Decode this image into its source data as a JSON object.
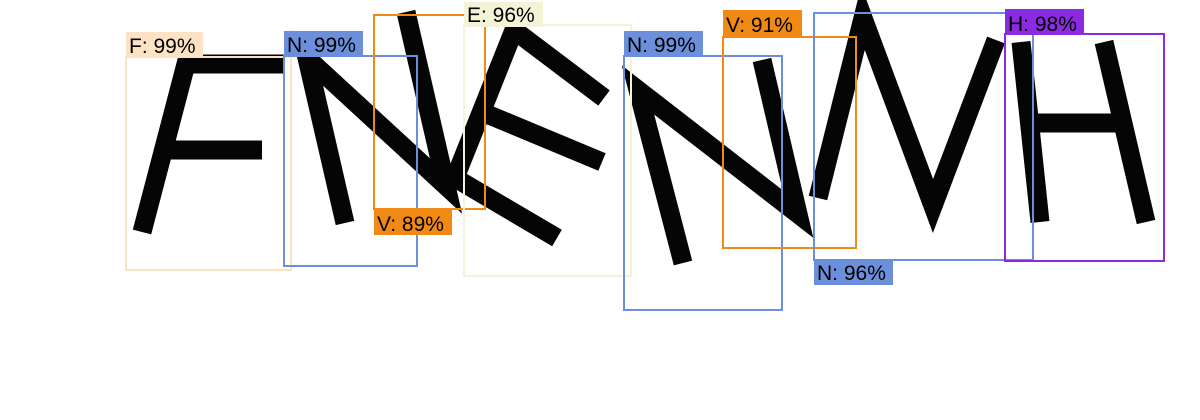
{
  "image": {
    "background": "#ffffff",
    "letters": [
      "F",
      "N",
      "E",
      "N",
      "V",
      "H"
    ]
  },
  "detections": [
    {
      "class_label": "F",
      "label": "F: 99%",
      "confidence": 0.99,
      "color": "#fde3c4",
      "text_color": "#000000"
    },
    {
      "class_label": "N",
      "label": "N: 99%",
      "confidence": 0.99,
      "color": "#6b8fdb",
      "text_color": "#000000"
    },
    {
      "class_label": "V",
      "label": "V: 89%",
      "confidence": 0.89,
      "color": "#f08a14",
      "text_color": "#000000"
    },
    {
      "class_label": "E",
      "label": "E: 96%",
      "confidence": 0.96,
      "color": "#f5f3d7",
      "text_color": "#000000"
    },
    {
      "class_label": "N",
      "label": "N: 99%",
      "confidence": 0.99,
      "color": "#6b8fdb",
      "text_color": "#000000"
    },
    {
      "class_label": "V",
      "label": "V: 91%",
      "confidence": 0.91,
      "color": "#f08a14",
      "text_color": "#000000"
    },
    {
      "class_label": "N",
      "label": "N: 96%",
      "confidence": 0.96,
      "color": "#6b8fdb",
      "text_color": "#000000"
    },
    {
      "class_label": "H",
      "label": "H: 98%",
      "confidence": 0.98,
      "color": "#8a2be2",
      "text_color": "#000000"
    }
  ]
}
